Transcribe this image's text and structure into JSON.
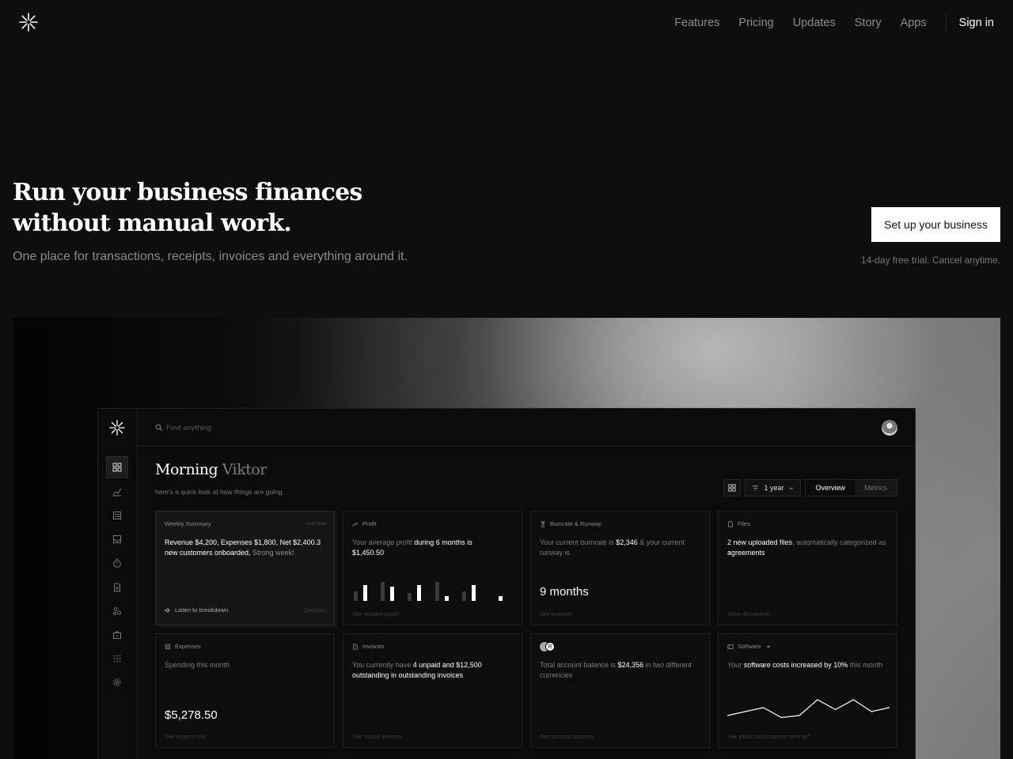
{
  "nav": {
    "items": [
      "Features",
      "Pricing",
      "Updates",
      "Story",
      "Apps"
    ],
    "signin": "Sign in"
  },
  "hero": {
    "title": "Run your business finances without manual work.",
    "subtitle": "One place for transactions, receipts, invoices and everything around it.",
    "cta": "Set up your business",
    "note": "14-day free trial. Cancel anytime."
  },
  "dashboard": {
    "search_placeholder": "Find anything",
    "greeting": {
      "hello": "Morning",
      "name": "Viktor"
    },
    "subtitle": "here's a quick look at how things are going.",
    "period": "1 year",
    "tabs": [
      "Overview",
      "Metrics"
    ],
    "summary": {
      "label": "Weekly Summary",
      "time": "Just now",
      "text": "Revenue $4,200, Expenses $1,800, Net $2,400.3 new customers onboarded,",
      "text_muted": "Strong week!",
      "listen": "Listen to breakdown",
      "dismiss": "Dismiss"
    },
    "profit": {
      "label": "Profit",
      "t1": "Your average profit",
      "t2": "during 6 months is",
      "t3": "$1,450.50",
      "foot": "See detailed graph",
      "bars": [
        {
          "gray": 12,
          "white": 20
        },
        {
          "gray": 24,
          "white": 18
        },
        {
          "gray": 10,
          "white": 20
        },
        {
          "gray": 24,
          "white": 6
        },
        {
          "gray": 12,
          "white": 20
        },
        {
          "gray": 0,
          "white": 6
        }
      ]
    },
    "burnrate": {
      "label": "Burnrate & Runway",
      "t1": "Your current burnrate is",
      "t2": "$2,346",
      "t3": "& your current runway is",
      "value": "9 months",
      "foot": "See burnrate"
    },
    "files": {
      "label": "Files",
      "t1": "2 new uploaded files",
      "t2": ", automatically categorized as",
      "t3": "agreements",
      "foot": "Show documents"
    },
    "expenses": {
      "label": "Expenses",
      "text": "Spending this month",
      "value": "$5,278.50",
      "foot": "See biggest cost"
    },
    "invoices": {
      "label": "Invoices",
      "t1": "You currently have",
      "t2": "4 unpaid and $12,500 outstanding in outstanding invoices",
      "foot": "See unpaid invoices"
    },
    "balance": {
      "coin": "R",
      "t1": "Total account balance is",
      "t2": "$24,356",
      "t3": "in two different currencies",
      "foot": "See account balances"
    },
    "software": {
      "label": "Software",
      "t1": "Your",
      "t2": "software costs increased by 10%",
      "t3": "this month",
      "foot": "See which subscriptions went up?",
      "trend": [
        8,
        12,
        16,
        6,
        8,
        24,
        14,
        24,
        12,
        16
      ]
    }
  },
  "colors": {
    "background": "#0e0e0e",
    "accent": "#ffffff",
    "muted": "#8c8c8c"
  }
}
